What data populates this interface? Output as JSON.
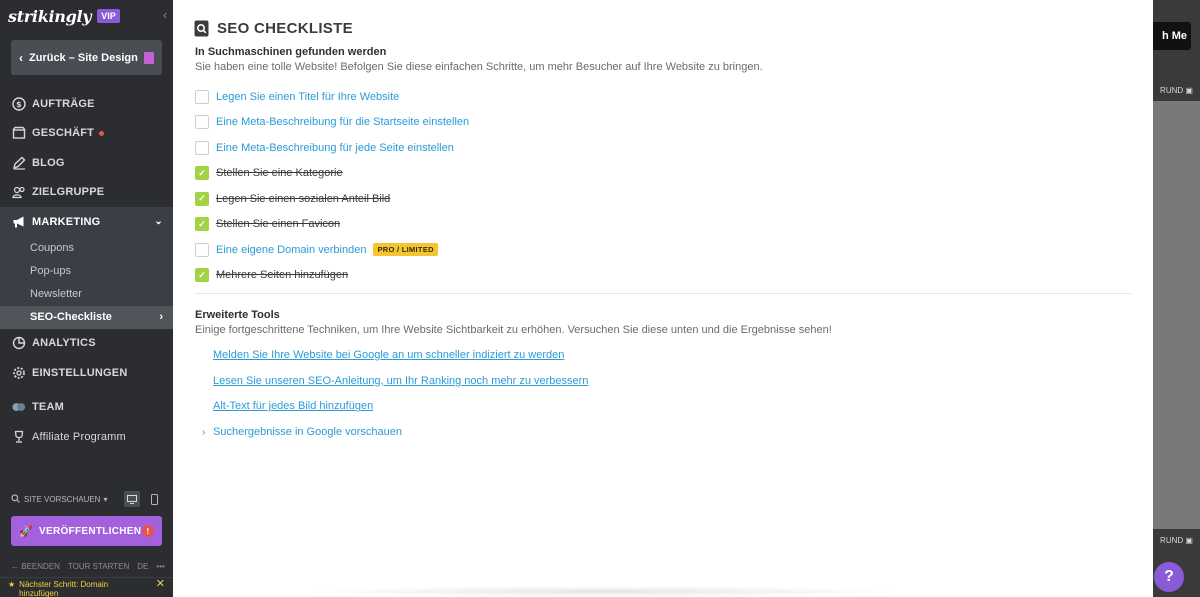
{
  "sidebar": {
    "brand": "strikingly",
    "vip": "VIP",
    "back_label": "Zurück – Site Design",
    "nav": [
      {
        "label": "AUFTRÄGE"
      },
      {
        "label": "GESCHÄFT"
      },
      {
        "label": "BLOG"
      },
      {
        "label": "ZIELGRUPPE"
      },
      {
        "label": "MARKETING"
      }
    ],
    "marketing_sub": [
      "Coupons",
      "Pop-ups",
      "Newsletter",
      "SEO-Checkliste"
    ],
    "nav2": [
      {
        "label": "ANALYTICS"
      },
      {
        "label": "EINSTELLUNGEN"
      },
      {
        "label": "TEAM"
      },
      {
        "label": "Affiliate Programm"
      }
    ],
    "preview_label": "SITE VORSCHAUEN",
    "publish_label": "VERÖFFENTLICHEN",
    "footer": {
      "end": "BEENDEN",
      "tour": "TOUR STARTEN",
      "lang": "DE",
      "more": "•••"
    },
    "next_step": "Nächster Schritt: Domain hinzufügen"
  },
  "editor": {
    "button_text": "h Me",
    "label_top": "RUND",
    "label_bottom": "RUND",
    "help": "?"
  },
  "panel": {
    "title": "SEO CHECKLISTE",
    "section1": {
      "heading": "In Suchmaschinen gefunden werden",
      "sub": "Sie haben eine tolle Website! Befolgen Sie diese einfachen Schritte, um mehr Besucher auf Ihre Website zu bringen.",
      "items": [
        {
          "label": "Legen Sie einen Titel für Ihre Website",
          "done": false
        },
        {
          "label": "Eine Meta-Beschreibung für die Startseite einstellen",
          "done": false
        },
        {
          "label": "Eine Meta-Beschreibung für jede Seite einstellen",
          "done": false
        },
        {
          "label": "Stellen Sie eine Kategorie",
          "done": true
        },
        {
          "label": "Legen Sie einen sozialen Anteil Bild",
          "done": true
        },
        {
          "label": "Stellen Sie einen Favicon",
          "done": true
        },
        {
          "label": "Eine eigene Domain verbinden",
          "done": false,
          "badge": "PRO / LIMITED"
        },
        {
          "label": "Mehrere Seiten hinzufügen",
          "done": true
        }
      ]
    },
    "section2": {
      "heading": "Erweiterte Tools",
      "sub": "Einige fortgeschrittene Techniken, um Ihre Website Sichtbarkeit zu erhöhen. Versuchen Sie diese unten und die Ergebnisse sehen!",
      "links": [
        "Melden Sie Ihre Website bei Google an um schneller indiziert zu werden",
        "Lesen Sie unseren SEO-Anleitung, um Ihr Ranking noch mehr zu verbessern",
        "Alt-Text für jedes Bild hinzufügen"
      ],
      "expander": "Suchergebnisse in Google vorschauen"
    }
  },
  "colors": {
    "sidebar_bg": "#2b2d31",
    "accent_purple": "#a361dd",
    "link_blue": "#2a9bd8",
    "check_green": "#a3d344",
    "badge_yellow": "#f4c531"
  }
}
